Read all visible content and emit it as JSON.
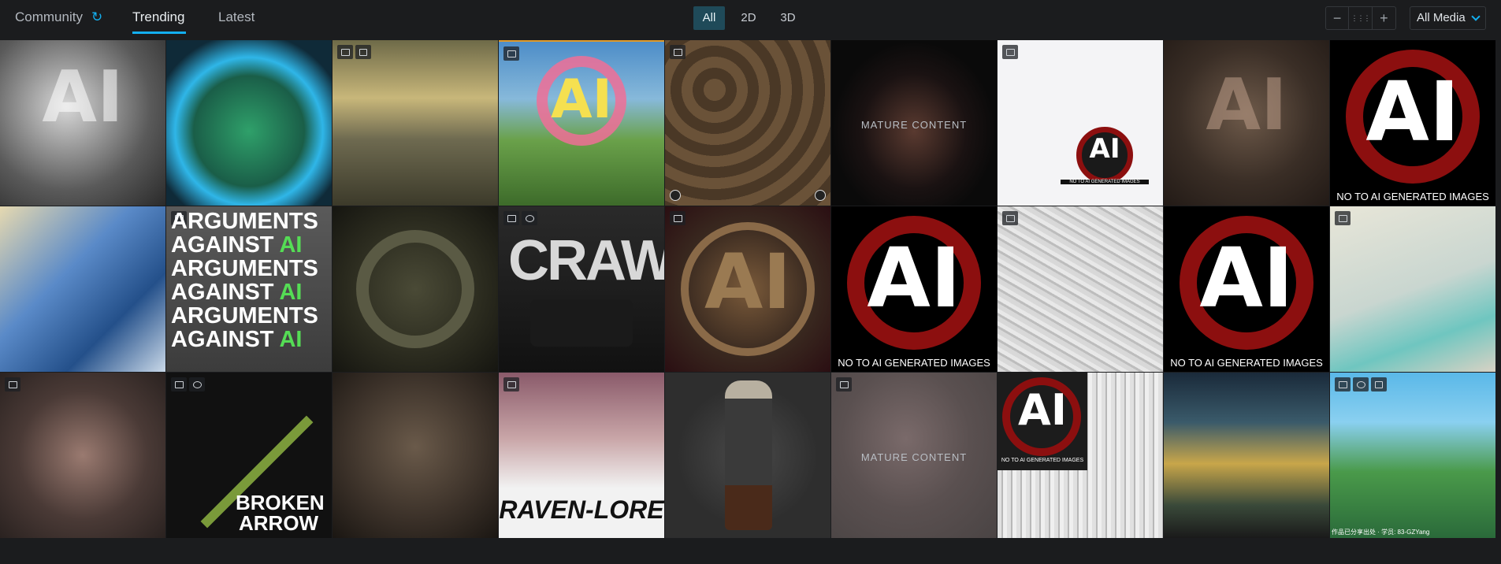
{
  "nav": {
    "community": "Community",
    "trending": "Trending",
    "latest": "Latest"
  },
  "filters": [
    {
      "label": "All",
      "active": true
    },
    {
      "label": "2D",
      "active": false
    },
    {
      "label": "3D",
      "active": false
    }
  ],
  "zoom": {
    "minus": "−",
    "grid": "⋮⋮⋮",
    "plus": "+"
  },
  "media_select": {
    "value": "All Media"
  },
  "labels": {
    "mature": "MATURE CONTENT",
    "no_ai": "NO TO AI GENERATED IMAGES",
    "args_word": "ARGUMENTS",
    "args_against": "AGAINST",
    "args_ai": "AI",
    "crawl": "CRAWL",
    "broken": "BROKEN",
    "arrow": "ARROW",
    "raven": "RAVEN-LORE",
    "ai": "AI",
    "sig": "作品已分享出处 · 学员: 83-GZYang"
  },
  "colors": {
    "accent": "#13aff0",
    "no_ai_red": "#8c0f0f"
  }
}
